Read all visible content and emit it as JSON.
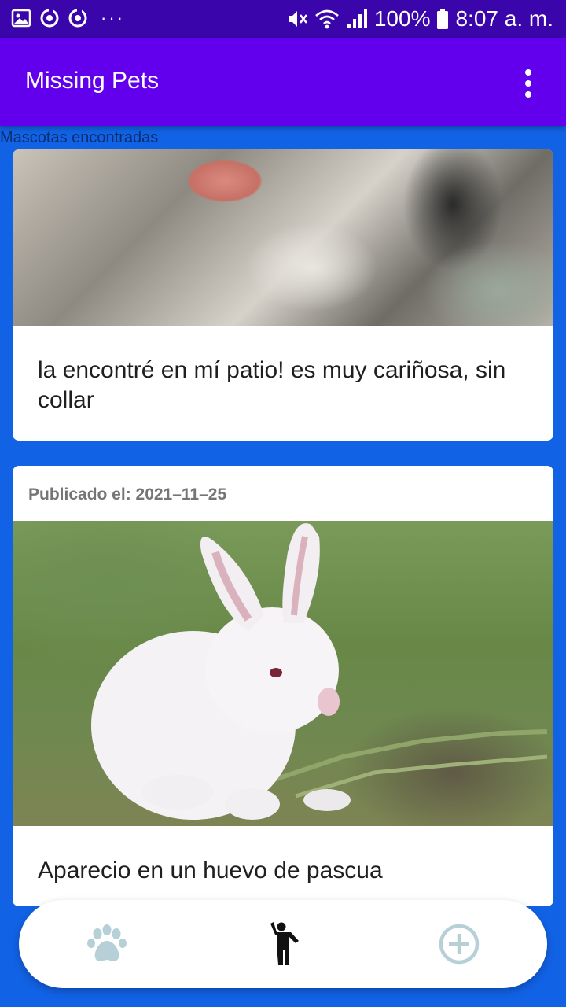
{
  "status_bar": {
    "left_icons": [
      "image-icon",
      "sync-icon",
      "sync-icon",
      "more-dots-icon"
    ],
    "battery": "100%",
    "time": "8:07 a. m."
  },
  "app_bar": {
    "title": "Missing Pets",
    "menu_icon": "more-vert-icon"
  },
  "section_label": "Mascotas encontradas",
  "posts": [
    {
      "image": "cat-photo",
      "description": "la encontré en mí patio! es muy cariñosa, sin collar"
    },
    {
      "date_label": "Publicado el: 2021–11–25",
      "image": "white-rabbit-photo",
      "description": "Aparecio en un huevo de pascua"
    }
  ],
  "bottom_nav": {
    "items": [
      {
        "icon": "paw-icon",
        "color": "#b7cfd6"
      },
      {
        "icon": "person-icon",
        "color": "#111111",
        "selected": true
      },
      {
        "icon": "add-circle-icon",
        "color": "#b7cfd6"
      }
    ]
  },
  "colors": {
    "status_bar": "#3a06ab",
    "app_bar": "#6200ee",
    "background": "#1262e6"
  }
}
